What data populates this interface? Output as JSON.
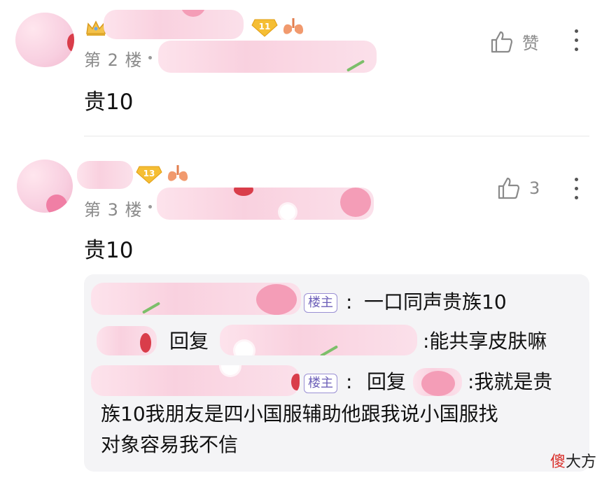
{
  "comments": [
    {
      "floor": "第 2 楼",
      "text": "贵10",
      "like_label": "赞",
      "level": "11"
    },
    {
      "floor": "第 3 楼",
      "text": "贵10",
      "like_label": "3",
      "level": "13"
    }
  ],
  "replies": [
    {
      "badge": "楼主",
      "colon": ":",
      "text": "一口同声贵族10"
    },
    {
      "prefix": "回复",
      "text": ":能共享皮肤嘛"
    },
    {
      "badge": "楼主",
      "colon": ":",
      "prefix": "回复",
      "text_line1": ":我就是贵",
      "text_line2": "族10我朋友是四小国服辅助他跟我说小国服找",
      "text_line3": "对象容易我不信"
    }
  ],
  "watermark": {
    "red": "傻",
    "black": "大方"
  },
  "colors": {
    "accent_badge": "#6c5fb8",
    "level_badge": "#f2b52a",
    "pink_blur": "#f9d1df"
  }
}
